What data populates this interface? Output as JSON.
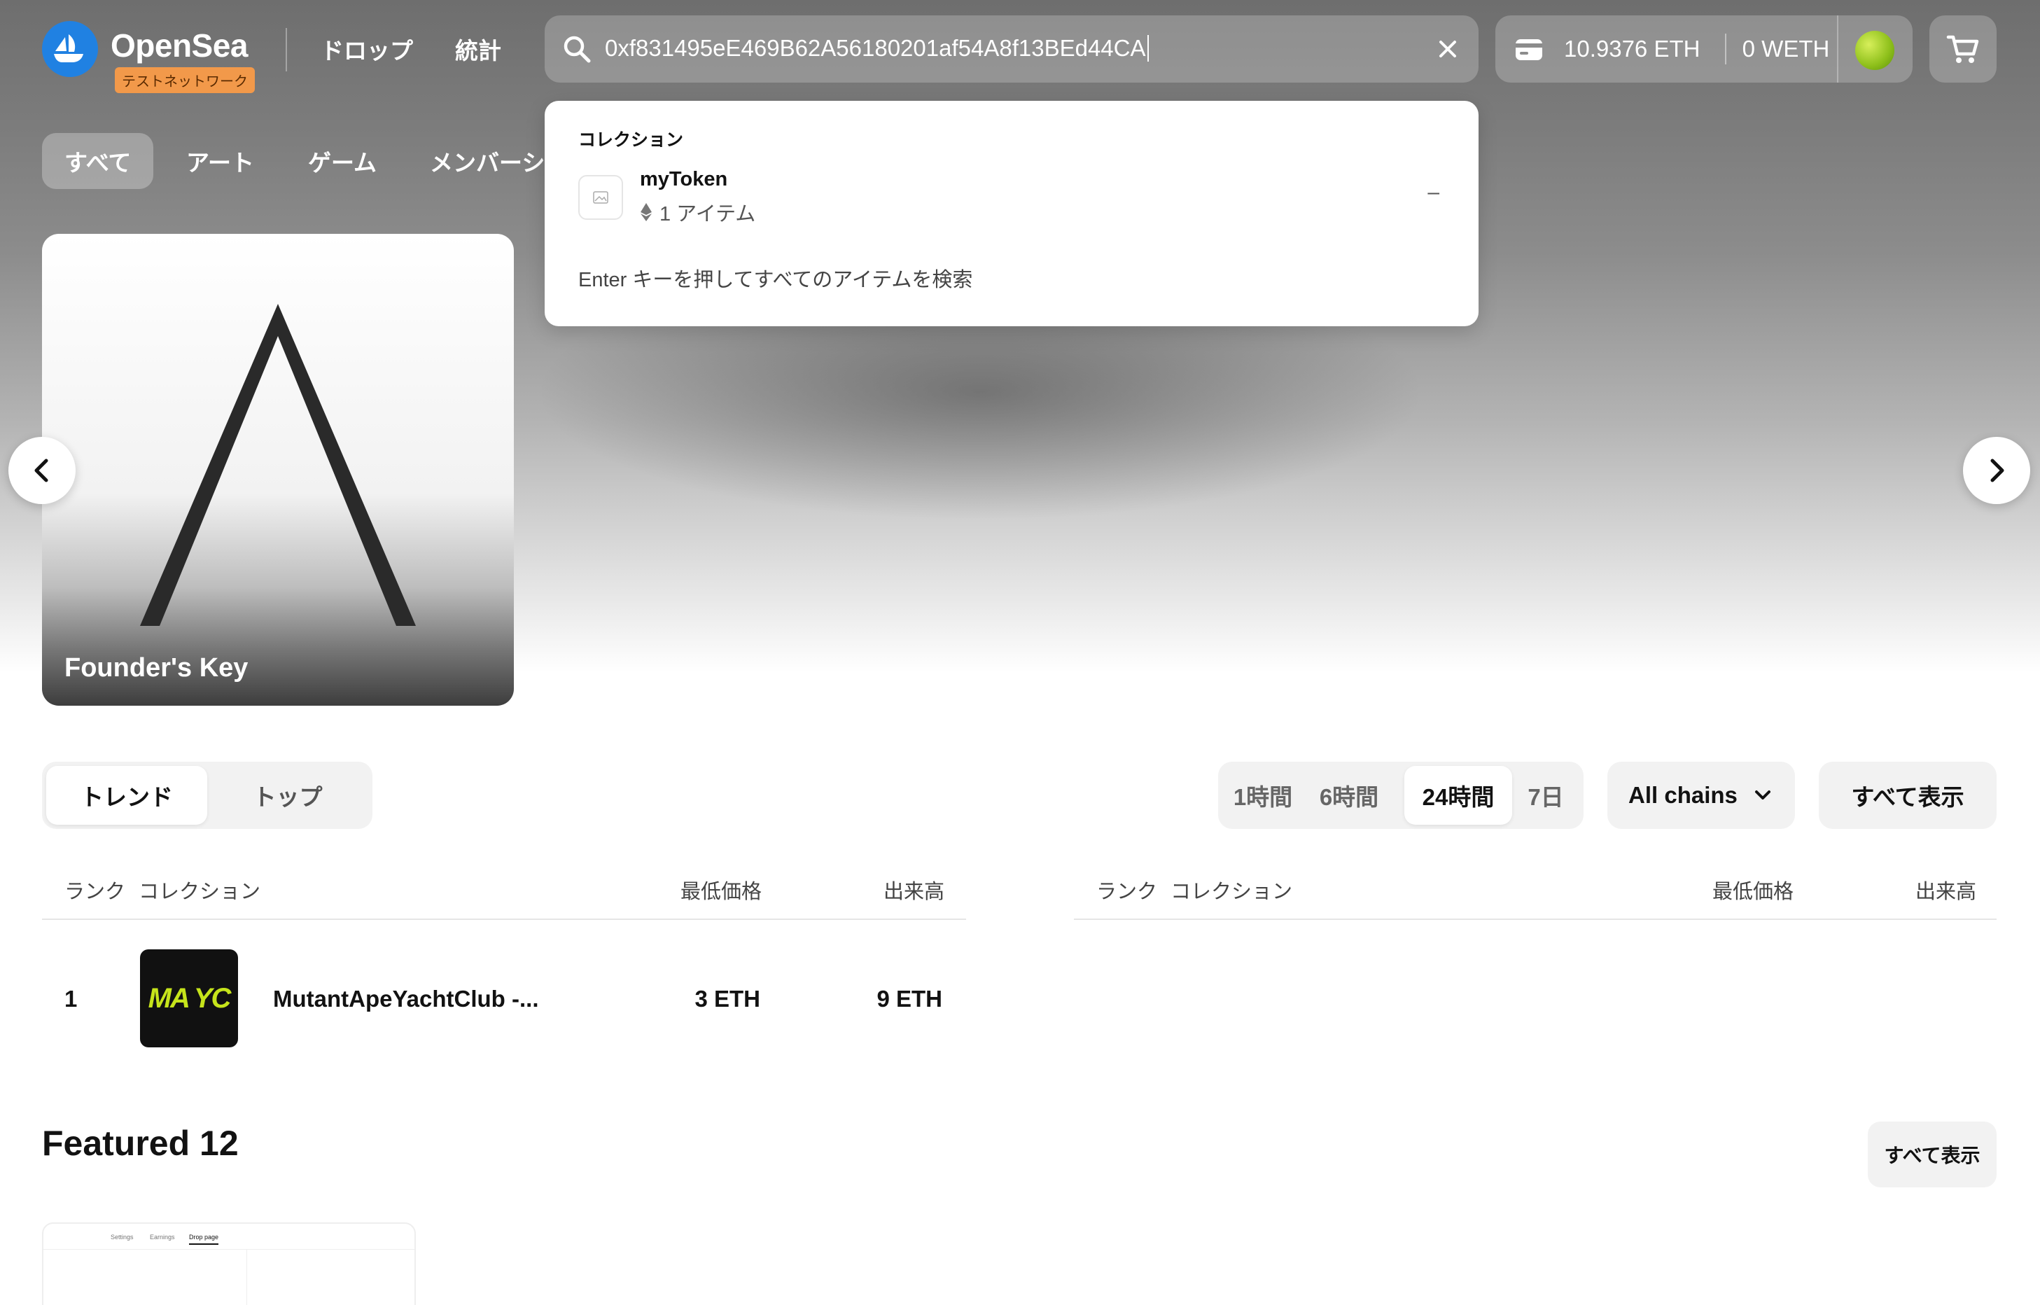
{
  "header": {
    "brand": "OpenSea",
    "testnet_badge": "テストネットワーク",
    "nav": [
      "ドロップ",
      "統計"
    ],
    "search_value": "0xf831495eE469B62A56180201af54A8f13BEd44CA",
    "wallet_eth": "10.9376 ETH",
    "wallet_weth": "0 WETH"
  },
  "categories": [
    "すべて",
    "アート",
    "ゲーム",
    "メンバーシ"
  ],
  "hero": {
    "card_title": "Founder's Key"
  },
  "search_dropdown": {
    "section": "コレクション",
    "item_name": "myToken",
    "item_count": "1 アイテム",
    "item_dash": "–",
    "hint": "Enter キーを押してすべてのアイテムを検索"
  },
  "rankings": {
    "tabs": [
      "トレンド",
      "トップ"
    ],
    "timeframes": [
      "1時間",
      "6時間",
      "24時間",
      "7日"
    ],
    "chains": "All chains",
    "view_all": "すべて表示",
    "columns": [
      "ランク",
      "コレクション",
      "最低価格",
      "出来高"
    ],
    "rows": [
      {
        "rank": "1",
        "name": "MutantApeYachtClub -...",
        "floor": "3 ETH",
        "volume": "9 ETH",
        "thumb_text": "MA YC"
      }
    ]
  },
  "featured": {
    "title": "Featured 12",
    "view_all": "すべて表示",
    "thumb_tabs": [
      "Settings",
      "Earnings",
      "Drop page"
    ]
  },
  "colors": {
    "logo_blue": "#2081e2",
    "testnet_orange": "#f2994a",
    "mayc_green": "#c6e41b"
  },
  "icons": [
    "search-icon",
    "close-icon",
    "wallet-icon",
    "cart-icon",
    "chevron-left-icon",
    "chevron-right-icon",
    "chevron-down-icon",
    "ethereum-icon",
    "image-placeholder-icon"
  ]
}
